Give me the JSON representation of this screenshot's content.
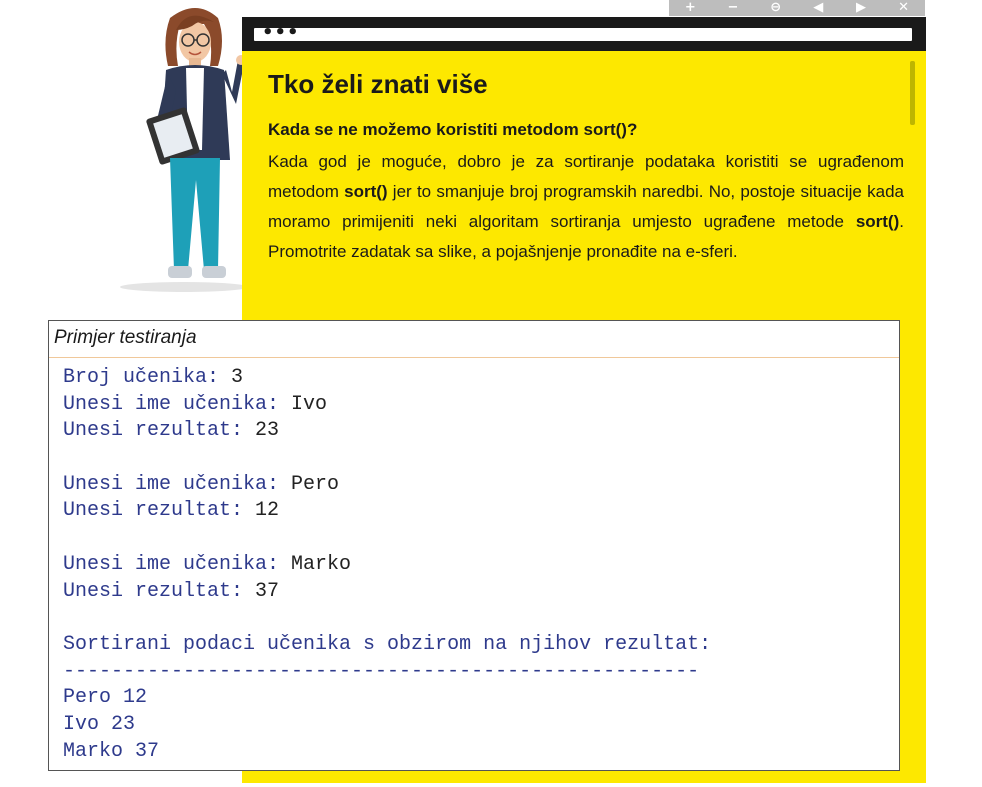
{
  "toolbar": {
    "buttons": [
      {
        "name": "zoom-in-button",
        "icon": "plus-icon",
        "glyph": "+"
      },
      {
        "name": "zoom-out-button",
        "icon": "minus-icon",
        "glyph": "−"
      },
      {
        "name": "zoom-reset-button",
        "icon": "zoom-reset-icon",
        "glyph": "⊖"
      },
      {
        "name": "prev-button",
        "icon": "arrow-left-icon",
        "glyph": "◀"
      },
      {
        "name": "next-button",
        "icon": "arrow-right-icon",
        "glyph": "▶"
      },
      {
        "name": "close-button",
        "icon": "close-icon",
        "glyph": "✕"
      }
    ]
  },
  "panel": {
    "title": "Tko želi znati više",
    "subtitle": "Kada se ne možemo koristiti metodom sort()?",
    "paragraph": [
      {
        "t": "Kada god je moguće, dobro je za sortiranje podataka koristiti se ugrađenom metodom ",
        "b": false
      },
      {
        "t": "sort()",
        "b": true
      },
      {
        "t": " jer to smanjuje broj programskih naredbi. No, postoje situacije kada moramo primijeniti neki algoritam sortiranja umjesto ugrađene metode ",
        "b": false
      },
      {
        "t": "sort()",
        "b": true
      },
      {
        "t": ". Promotrite zadatak sa slike, a pojašnjenje pronađite na e-sferi.",
        "b": false
      }
    ]
  },
  "example": {
    "header": "Primjer testiranja",
    "lines": [
      {
        "prompt": "Broj učenika: ",
        "value": "3"
      },
      {
        "prompt": "Unesi ime učenika: ",
        "value": "Ivo"
      },
      {
        "prompt": "Unesi rezultat: ",
        "value": "23"
      },
      {
        "prompt": "",
        "value": ""
      },
      {
        "prompt": "Unesi ime učenika: ",
        "value": "Pero"
      },
      {
        "prompt": "Unesi rezultat: ",
        "value": "12"
      },
      {
        "prompt": "",
        "value": ""
      },
      {
        "prompt": "Unesi ime učenika: ",
        "value": "Marko"
      },
      {
        "prompt": "Unesi rezultat: ",
        "value": "37"
      },
      {
        "prompt": "",
        "value": ""
      },
      {
        "prompt": "Sortirani podaci učenika s obzirom na njihov rezultat:",
        "value": ""
      },
      {
        "prompt": "-----------------------------------------------------",
        "value": ""
      },
      {
        "prompt": "Pero 12",
        "value": ""
      },
      {
        "prompt": "Ivo 23",
        "value": ""
      },
      {
        "prompt": "Marko 37",
        "value": ""
      }
    ]
  },
  "colors": {
    "panel_yellow": "#fde800",
    "panel_bar": "#1a1a1a",
    "console_prompt": "#2e3a8c",
    "console_value": "#222222"
  }
}
